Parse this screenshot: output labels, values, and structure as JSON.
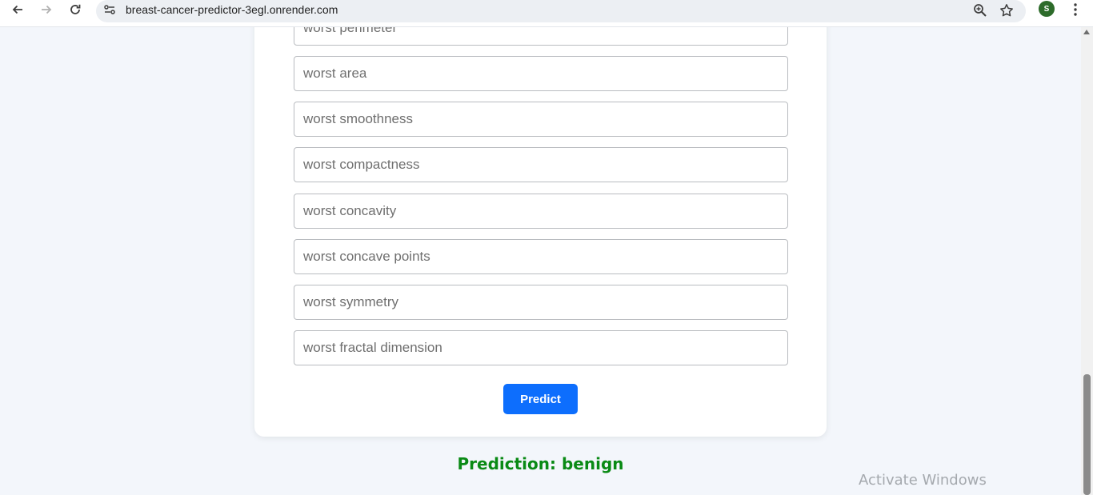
{
  "browser": {
    "url": "breast-cancer-predictor-3egl.onrender.com",
    "profile_initial": "S",
    "icons": {
      "back": "back-arrow-icon",
      "forward": "forward-arrow-icon",
      "reload": "reload-icon",
      "site_info": "site-settings-icon",
      "zoom": "zoom-icon",
      "bookmark": "star-icon",
      "menu": "kebab-menu-icon"
    }
  },
  "form": {
    "fields": [
      {
        "placeholder": "worst perimeter"
      },
      {
        "placeholder": "worst area"
      },
      {
        "placeholder": "worst smoothness"
      },
      {
        "placeholder": "worst compactness"
      },
      {
        "placeholder": "worst concavity"
      },
      {
        "placeholder": "worst concave points"
      },
      {
        "placeholder": "worst symmetry"
      },
      {
        "placeholder": "worst fractal dimension"
      }
    ],
    "submit_label": "Predict"
  },
  "result": {
    "text": "Prediction: benign",
    "color": "#0a8a15"
  },
  "overlay": {
    "watermark": "Activate Windows"
  },
  "theme": {
    "accent": "#0d6efd",
    "background": "#f3f6fb"
  }
}
